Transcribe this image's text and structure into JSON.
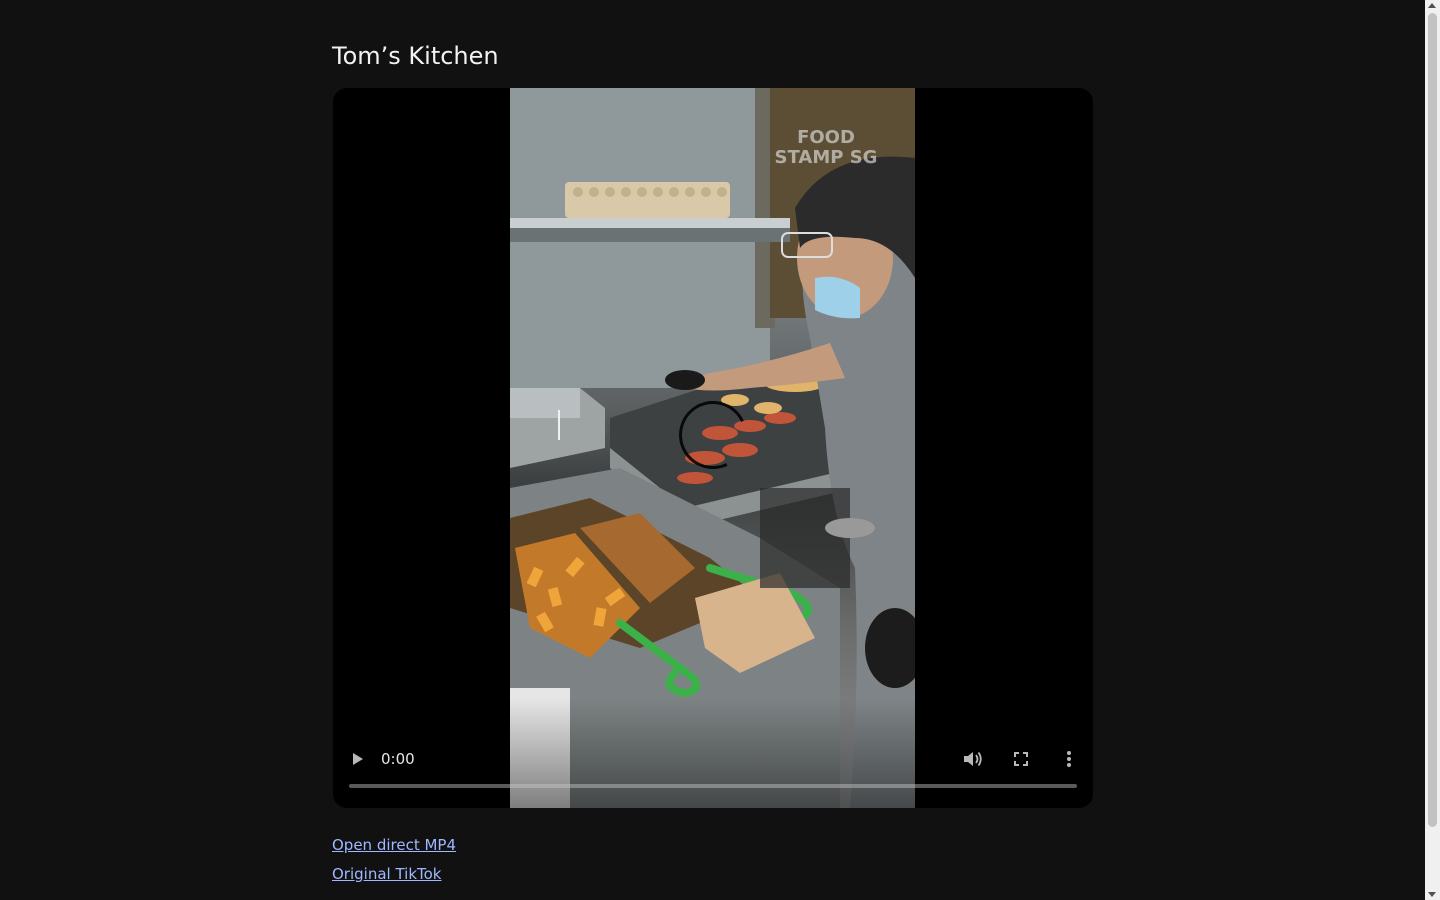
{
  "page": {
    "title": "Tom’s Kitchen"
  },
  "video": {
    "watermark": "FOOD\nSTAMP SG",
    "current_time": "0:00",
    "progress_fraction": 0,
    "icons": {
      "play": "play-icon",
      "volume": "volume-icon",
      "fullscreen": "fullscreen-icon",
      "more": "more-options-icon"
    }
  },
  "links": {
    "mp4": "Open direct MP4",
    "tiktok": "Original TikTok"
  },
  "colors": {
    "background": "#111111",
    "link": "#9fb8ff",
    "player": "#000000"
  }
}
